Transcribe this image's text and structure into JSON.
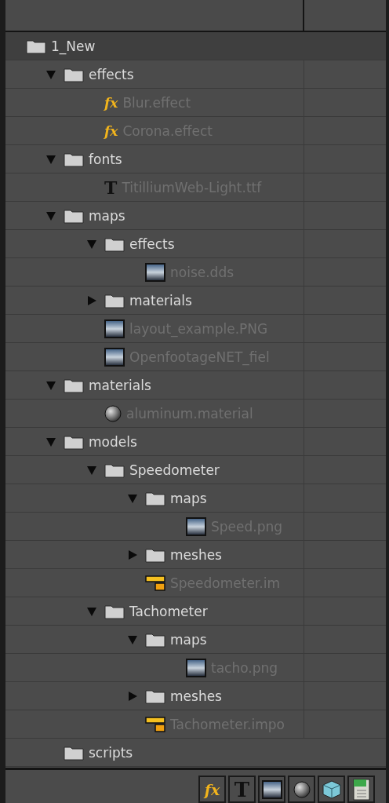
{
  "tree": {
    "name": "1_New",
    "kind": "folder",
    "selected": true,
    "children": [
      {
        "name": "effects",
        "kind": "folder",
        "selected": false,
        "expanded": true,
        "children": [
          {
            "name": "Blur.effect",
            "kind": "effect",
            "glyph": "fx",
            "selected": false
          },
          {
            "name": "Corona.effect",
            "kind": "effect",
            "glyph": "fx",
            "selected": false
          }
        ]
      },
      {
        "name": "fonts",
        "kind": "folder",
        "selected": false,
        "expanded": true,
        "children": [
          {
            "name": "TitilliumWeb-Light.ttf",
            "kind": "font",
            "glyph": "T",
            "selected": false
          }
        ]
      },
      {
        "name": "maps",
        "kind": "folder",
        "selected": false,
        "expanded": true,
        "children": [
          {
            "name": "effects",
            "kind": "folder",
            "selected": false,
            "expanded": true,
            "children": [
              {
                "name": "noise.dds",
                "kind": "image",
                "selected": false
              }
            ]
          },
          {
            "name": "materials",
            "kind": "folder",
            "selected": false,
            "expanded": false
          },
          {
            "name": "layout_example.PNG",
            "kind": "image",
            "selected": false
          },
          {
            "name": "OpenfootageNET_fiel",
            "kind": "image",
            "selected": false
          }
        ]
      },
      {
        "name": "materials",
        "kind": "folder",
        "selected": false,
        "expanded": true,
        "children": [
          {
            "name": "aluminum.material",
            "kind": "material",
            "selected": false
          }
        ]
      },
      {
        "name": "models",
        "kind": "folder",
        "selected": false,
        "expanded": true,
        "children": [
          {
            "name": "Speedometer",
            "kind": "folder",
            "selected": false,
            "expanded": true,
            "children": [
              {
                "name": "maps",
                "kind": "folder",
                "selected": false,
                "expanded": true,
                "children": [
                  {
                    "name": "Speed.png",
                    "kind": "image",
                    "selected": false
                  }
                ]
              },
              {
                "name": "meshes",
                "kind": "folder",
                "selected": false,
                "expanded": false
              },
              {
                "name": "Speedometer.im",
                "kind": "import",
                "selected": false
              }
            ]
          },
          {
            "name": "Tachometer",
            "kind": "folder",
            "selected": false,
            "expanded": true,
            "children": [
              {
                "name": "maps",
                "kind": "folder",
                "selected": false,
                "expanded": true,
                "children": [
                  {
                    "name": "tacho.png",
                    "kind": "image",
                    "selected": false
                  }
                ]
              },
              {
                "name": "meshes",
                "kind": "folder",
                "selected": false,
                "expanded": false
              },
              {
                "name": "Tachometer.impo",
                "kind": "import",
                "selected": false
              }
            ]
          }
        ]
      },
      {
        "name": "scripts",
        "kind": "folder",
        "selected": false
      }
    ]
  },
  "toolbar": [
    {
      "kind": "effect",
      "glyph": "fx"
    },
    {
      "kind": "font",
      "glyph": "T"
    },
    {
      "kind": "image"
    },
    {
      "kind": "material"
    },
    {
      "kind": "model"
    },
    {
      "kind": "script"
    }
  ]
}
